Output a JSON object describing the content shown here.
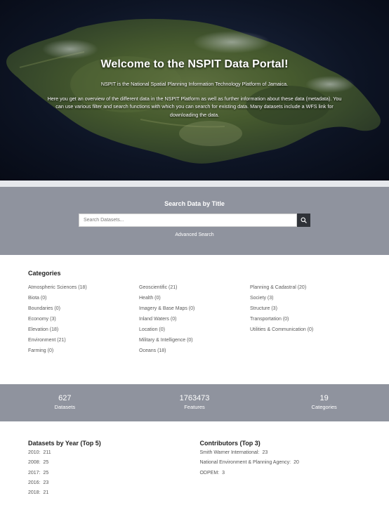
{
  "hero": {
    "title": "Welcome to the NSPIT Data Portal!",
    "intro": "NSPIT is the National Spatial Planning Information Technology Platform of Jamaica.",
    "description": "Here you get an overview of the different data in the NSPIT Platform as well as further information about these data (metadata). You can use various filter and search functions with which you can search for existing data. Many datasets include a WFS link for downloading the data."
  },
  "search": {
    "title": "Search Data by Title",
    "placeholder": "Search Datasets...",
    "advanced_label": "Advanced Search",
    "button_icon": "search-icon"
  },
  "categories": {
    "title": "Categories",
    "columns": [
      [
        "Atmospheric Sciences (18)",
        "Biota (0)",
        "Boundaries (0)",
        "Economy (3)",
        "Elevation (18)",
        "Environment (21)",
        "Farming (0)"
      ],
      [
        "Geoscientific (21)",
        "Health (0)",
        "Imagery & Base Maps (0)",
        "Inland Waters (0)",
        "Location (0)",
        "Military & Intelligence (0)",
        "Oceans (18)"
      ],
      [
        "Planning & Cadastral (20)",
        "Society (3)",
        "Structure (3)",
        "Transportation (0)",
        "Utilities & Communication (0)"
      ]
    ]
  },
  "stats": [
    {
      "value": "627",
      "label": "Datasets"
    },
    {
      "value": "1763473",
      "label": "Features"
    },
    {
      "value": "19",
      "label": "Categories"
    }
  ],
  "years": {
    "title": "Datasets by Year (Top 5)",
    "items": [
      {
        "year": "2010:",
        "count": "211"
      },
      {
        "year": "2008:",
        "count": "25"
      },
      {
        "year": "2017:",
        "count": "25"
      },
      {
        "year": "2016:",
        "count": "23"
      },
      {
        "year": "2018:",
        "count": "21"
      }
    ]
  },
  "contributors": {
    "title": "Contributors (Top 3)",
    "items": [
      {
        "name": "Smith Warner International:",
        "count": "23"
      },
      {
        "name": "National Environment & Planning Agency:",
        "count": "20"
      },
      {
        "name": "ODPEM:",
        "count": "3"
      }
    ]
  },
  "colors": {
    "section_gray": "#8f939e",
    "search_button": "#2f3238",
    "hero_night": "#0d1424"
  }
}
